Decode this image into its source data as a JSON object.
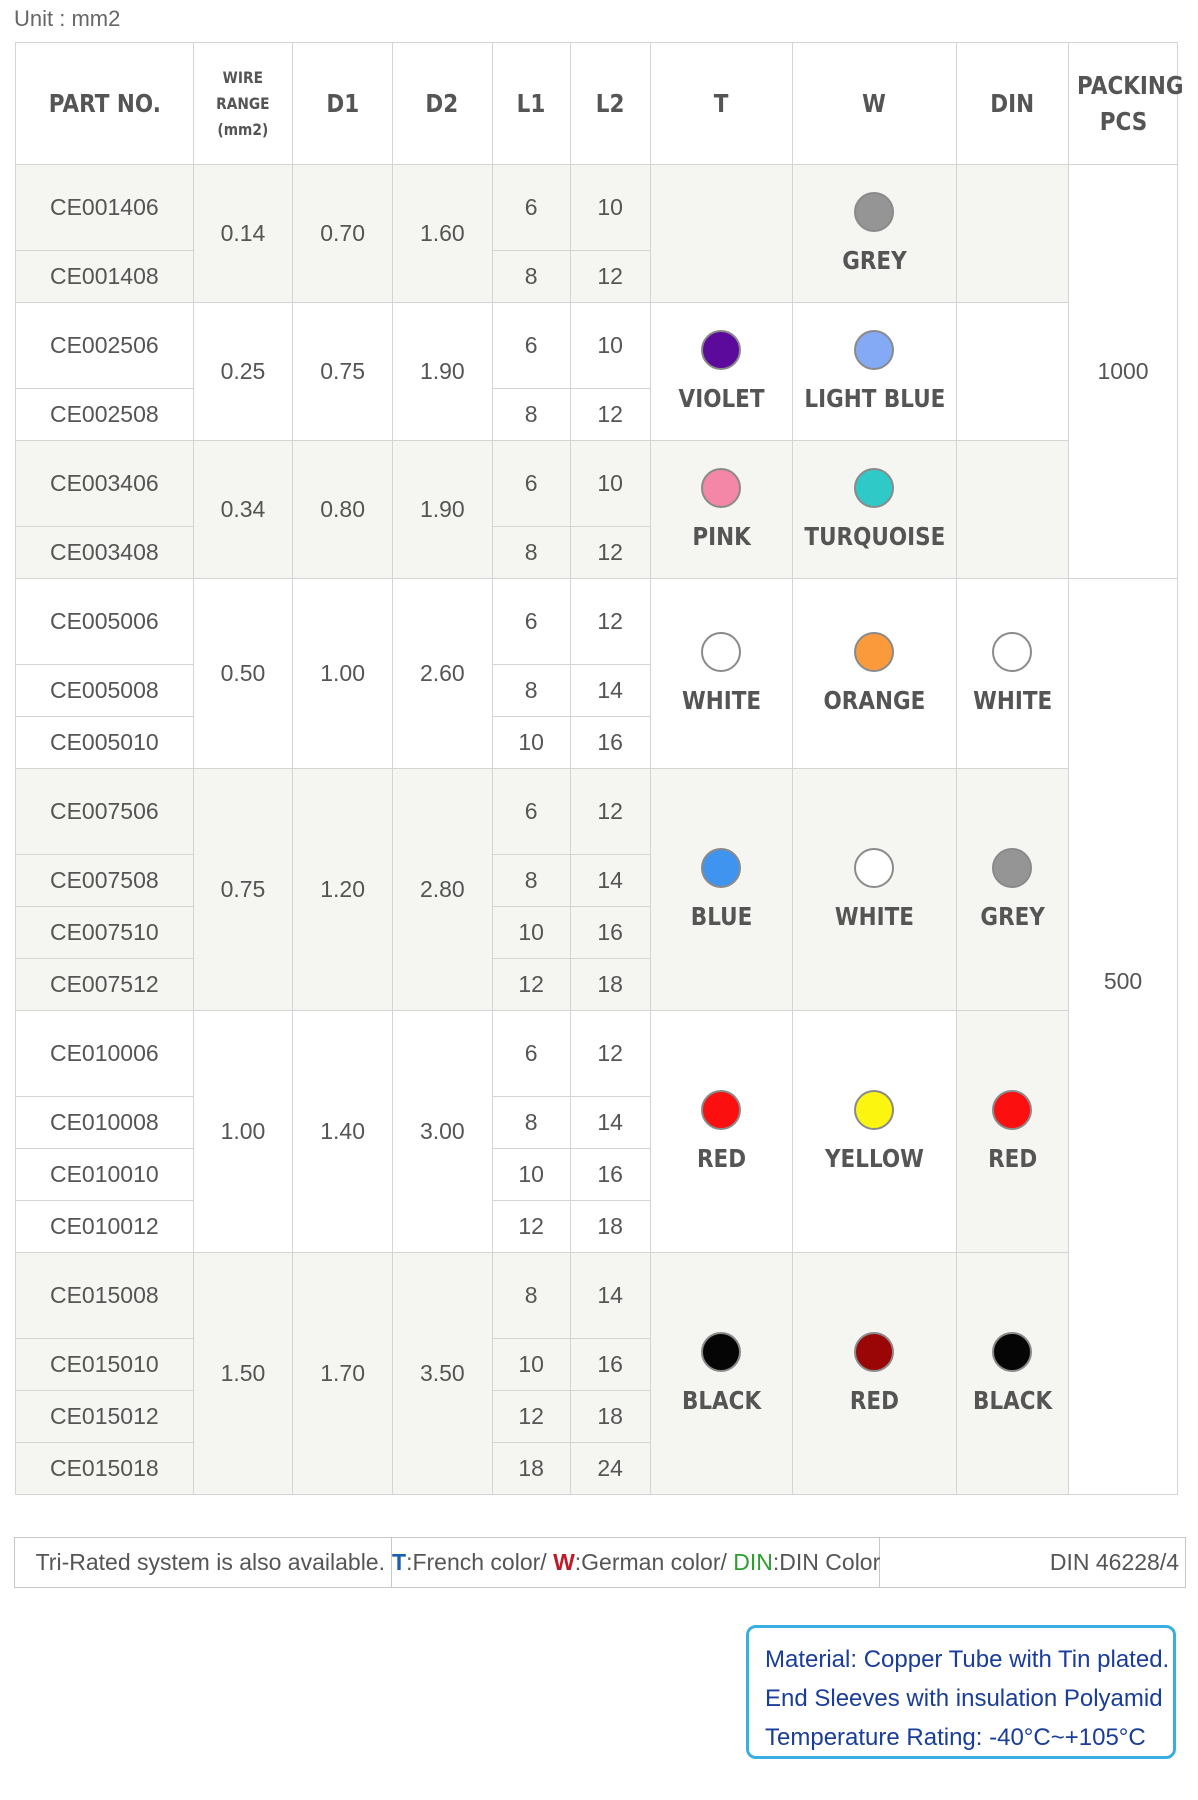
{
  "unit_label": "Unit : mm2",
  "headers": {
    "part_no": "PART NO.",
    "wire_range_1": "WIRE RANGE",
    "wire_range_2": "(mm2)",
    "d1": "D1",
    "d2": "D2",
    "l1": "L1",
    "l2": "L2",
    "t": "T",
    "w": "W",
    "din": "DIN",
    "packing_1": "PACKING",
    "packing_2": "PCS"
  },
  "colors": {
    "GREY": "#959595",
    "VIOLET": "#5c0a9b",
    "LIGHT BLUE": "#84aaf5",
    "PINK": "#f486a8",
    "TURQUOISE": "#2fcac8",
    "WHITE": "#ffffff",
    "ORANGE": "#fb9a3a",
    "BLUE": "#3f94f0",
    "RED": "#fb0f0f",
    "YELLOW": "#fbf50f",
    "BLACK": "#050505",
    "DARK RED": "#9a0606"
  },
  "packing": [
    "1000",
    "500"
  ],
  "groups": [
    {
      "wire_range": "0.14",
      "d1": "0.70",
      "d2": "1.60",
      "t": {
        "name": "",
        "dot": ""
      },
      "w": {
        "name": "GREY",
        "dot": "GREY"
      },
      "din": {
        "name": "",
        "dot": ""
      },
      "parts": [
        {
          "part": "CE001406",
          "l1": "6",
          "l2": "10"
        },
        {
          "part": "CE001408",
          "l1": "8",
          "l2": "12"
        }
      ]
    },
    {
      "wire_range": "0.25",
      "d1": "0.75",
      "d2": "1.90",
      "t": {
        "name": "VIOLET",
        "dot": "VIOLET"
      },
      "w": {
        "name": "LIGHT BLUE",
        "dot": "LIGHT BLUE"
      },
      "din": {
        "name": "",
        "dot": ""
      },
      "parts": [
        {
          "part": "CE002506",
          "l1": "6",
          "l2": "10"
        },
        {
          "part": "CE002508",
          "l1": "8",
          "l2": "12"
        }
      ]
    },
    {
      "wire_range": "0.34",
      "d1": "0.80",
      "d2": "1.90",
      "t": {
        "name": "PINK",
        "dot": "PINK"
      },
      "w": {
        "name": "TURQUOISE",
        "dot": "TURQUOISE"
      },
      "din": {
        "name": "",
        "dot": ""
      },
      "parts": [
        {
          "part": "CE003406",
          "l1": "6",
          "l2": "10"
        },
        {
          "part": "CE003408",
          "l1": "8",
          "l2": "12"
        }
      ]
    },
    {
      "wire_range": "0.50",
      "d1": "1.00",
      "d2": "2.60",
      "t": {
        "name": "WHITE",
        "dot": "WHITE"
      },
      "w": {
        "name": "ORANGE",
        "dot": "ORANGE"
      },
      "din": {
        "name": "WHITE",
        "dot": "WHITE"
      },
      "parts": [
        {
          "part": "CE005006",
          "l1": "6",
          "l2": "12"
        },
        {
          "part": "CE005008",
          "l1": "8",
          "l2": "14"
        },
        {
          "part": "CE005010",
          "l1": "10",
          "l2": "16"
        }
      ]
    },
    {
      "wire_range": "0.75",
      "d1": "1.20",
      "d2": "2.80",
      "t": {
        "name": "BLUE",
        "dot": "BLUE"
      },
      "w": {
        "name": "WHITE",
        "dot": "WHITE"
      },
      "din": {
        "name": "GREY",
        "dot": "GREY"
      },
      "parts": [
        {
          "part": "CE007506",
          "l1": "6",
          "l2": "12"
        },
        {
          "part": "CE007508",
          "l1": "8",
          "l2": "14"
        },
        {
          "part": "CE007510",
          "l1": "10",
          "l2": "16"
        },
        {
          "part": "CE007512",
          "l1": "12",
          "l2": "18"
        }
      ]
    },
    {
      "wire_range": "1.00",
      "d1": "1.40",
      "d2": "3.00",
      "t": {
        "name": "RED",
        "dot": "RED"
      },
      "w": {
        "name": "YELLOW",
        "dot": "YELLOW"
      },
      "din": {
        "name": "RED",
        "dot": "RED"
      },
      "parts": [
        {
          "part": "CE010006",
          "l1": "6",
          "l2": "12"
        },
        {
          "part": "CE010008",
          "l1": "8",
          "l2": "14"
        },
        {
          "part": "CE010010",
          "l1": "10",
          "l2": "16"
        },
        {
          "part": "CE010012",
          "l1": "12",
          "l2": "18"
        }
      ]
    },
    {
      "wire_range": "1.50",
      "d1": "1.70",
      "d2": "3.50",
      "t": {
        "name": "BLACK",
        "dot": "BLACK"
      },
      "w": {
        "name": "RED",
        "dot": "DARK RED"
      },
      "din": {
        "name": "BLACK",
        "dot": "BLACK"
      },
      "parts": [
        {
          "part": "CE015008",
          "l1": "8",
          "l2": "14"
        },
        {
          "part": "CE015010",
          "l1": "10",
          "l2": "16"
        },
        {
          "part": "CE015012",
          "l1": "12",
          "l2": "18"
        },
        {
          "part": "CE015018",
          "l1": "18",
          "l2": "24"
        }
      ]
    }
  ],
  "footer": {
    "tri_rated": "Tri-Rated system is also available.",
    "legend_t_key": "T",
    "legend_t_text": ":French color/ ",
    "legend_w_key": "W",
    "legend_w_text": ":German color/ ",
    "legend_din_key": "DIN",
    "legend_din_text": ":DIN Color",
    "standard": "DIN 46228/4"
  },
  "material": {
    "line1": "Material: Copper Tube with Tin plated.",
    "line2": "End Sleeves with insulation Polyamid",
    "line3": "Temperature Rating: -40°C~+105°C"
  }
}
